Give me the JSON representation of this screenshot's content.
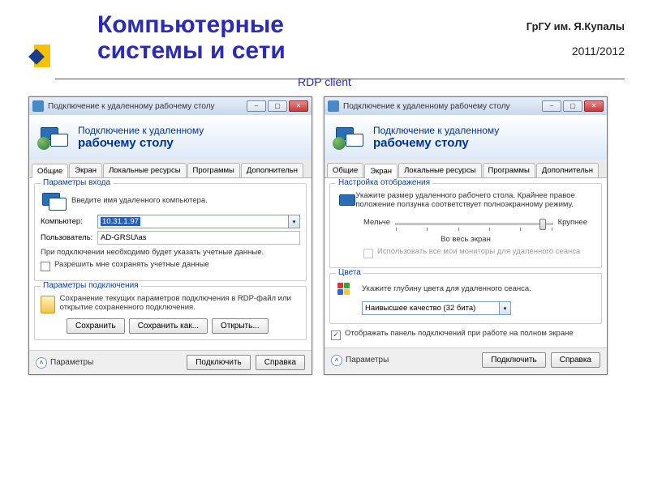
{
  "slide": {
    "title_l1": "Компьютерные",
    "title_l2": "системы и сети",
    "university": "ГрГУ им. Я.Купалы",
    "year": "2011/2012",
    "subtitle": "RDP client"
  },
  "win1": {
    "title": "Подключение к удаленному рабочему столу",
    "banner_l1": "Подключение к удаленному",
    "banner_l2": "рабочему столу",
    "tabs": [
      "Общие",
      "Экран",
      "Локальные ресурсы",
      "Программы",
      "Дополнительн"
    ],
    "active_tab": 0,
    "group_login_title": "Параметры входа",
    "login_desc": "Введите имя удаленного компьютера.",
    "label_computer": "Компьютер:",
    "value_computer": "10.31.1.97",
    "label_user": "Пользователь:",
    "value_user": "AD-GRSU\\as",
    "login_note": "При подключении необходимо будет указать учетные данные.",
    "chk_save_creds": "Разрешить мне сохранять учетные данные",
    "group_conn_title": "Параметры подключения",
    "conn_desc": "Сохранение текущих параметров подключения в RDP-файл или открытие сохраненного подключения.",
    "btn_save": "Сохранить",
    "btn_save_as": "Сохранить как...",
    "btn_open": "Открыть...",
    "footer_params": "Параметры",
    "btn_connect": "Подключить",
    "btn_help": "Справка"
  },
  "win2": {
    "title": "Подключение к удаленному рабочему столу",
    "banner_l1": "Подключение к удаленному",
    "banner_l2": "рабочему столу",
    "tabs": [
      "Общие",
      "Экран",
      "Локальные ресурсы",
      "Программы",
      "Дополнительн"
    ],
    "active_tab": 1,
    "group_display_title": "Настройка отображения",
    "display_desc": "Укажите размер удаленного рабочего стола. Крайнее правое положение ползунка соответствует полноэкранному режиму.",
    "slider_small": "Мельче",
    "slider_large": "Крупнее",
    "slider_value_label": "Во весь экран",
    "chk_all_monitors": "Использовать все мои мониторы для удаленного сеанса",
    "group_colors_title": "Цвета",
    "colors_desc": "Укажите глубину цвета для удаленного сеанса.",
    "color_depth": "Наивысшее качество (32 бита)",
    "chk_connection_bar": "Отображать панель подключений при работе на полном экране",
    "footer_params": "Параметры",
    "btn_connect": "Подключить",
    "btn_help": "Справка"
  }
}
